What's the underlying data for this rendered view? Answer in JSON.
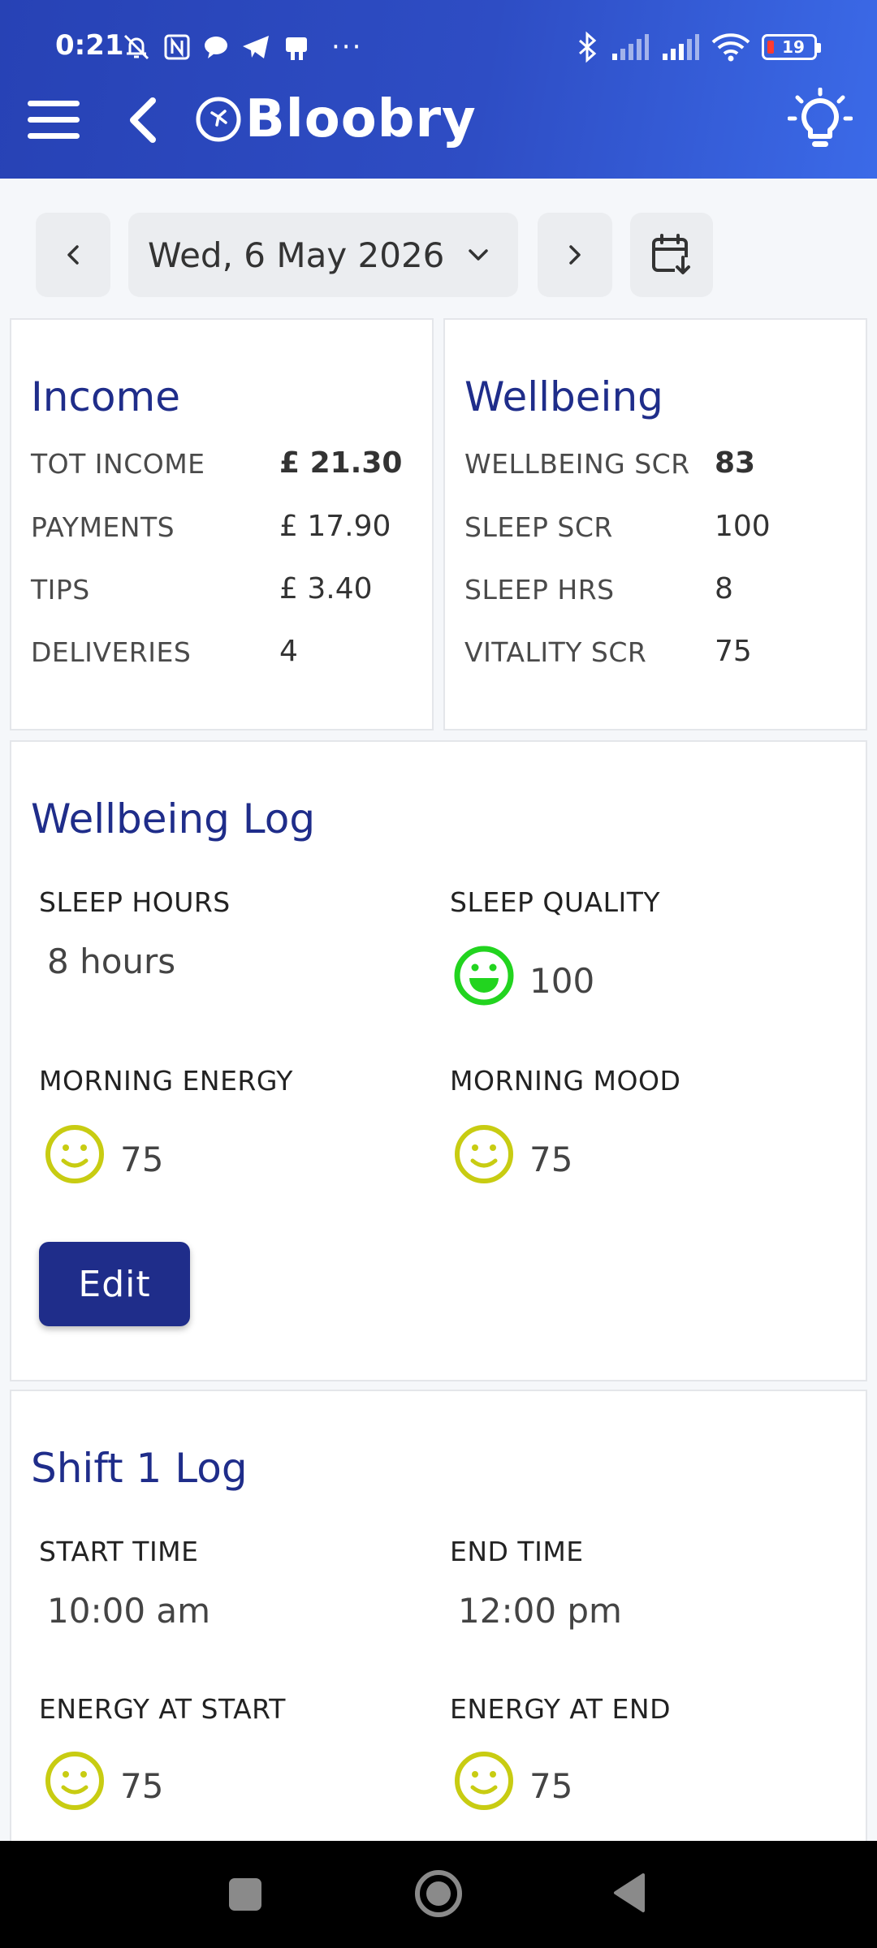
{
  "status_bar": {
    "time": "0:21",
    "battery": "19"
  },
  "header": {
    "brand_name": "Bloobry"
  },
  "date_nav": {
    "date": "Wed, 6 May 2026"
  },
  "income": {
    "title": "Income",
    "rows": [
      {
        "label": "TOT INCOME",
        "value": "£ 21.30"
      },
      {
        "label": "PAYMENTS",
        "value": "£ 17.90"
      },
      {
        "label": "TIPS",
        "value": "£ 3.40"
      },
      {
        "label": "DELIVERIES",
        "value": "4"
      }
    ]
  },
  "wellbeing": {
    "title": "Wellbeing",
    "rows": [
      {
        "label": "WELLBEING SCR",
        "value": "83"
      },
      {
        "label": "SLEEP SCR",
        "value": "100"
      },
      {
        "label": "SLEEP HRS",
        "value": "8"
      },
      {
        "label": "VITALITY SCR",
        "value": "75"
      }
    ]
  },
  "wellbeing_log": {
    "title": "Wellbeing Log",
    "sleep_hours_label": "SLEEP HOURS",
    "sleep_hours_value": "8 hours",
    "sleep_quality_label": "SLEEP QUALITY",
    "sleep_quality_value": "100",
    "morning_energy_label": "MORNING ENERGY",
    "morning_energy_value": "75",
    "morning_mood_label": "MORNING MOOD",
    "morning_mood_value": "75",
    "edit_label": "Edit"
  },
  "shift_log": {
    "title": "Shift 1 Log",
    "start_time_label": "START TIME",
    "start_time_value": "10:00 am",
    "end_time_label": "END TIME",
    "end_time_value": "12:00 pm",
    "energy_start_label": "ENERGY AT START",
    "energy_start_value": "75",
    "energy_end_label": "ENERGY AT END",
    "energy_end_value": "75"
  },
  "colors": {
    "header_blue": "#2742b5",
    "title_navy": "#1f2d8a",
    "face_green": "#22d41f",
    "face_yellow": "#c8cc12"
  }
}
